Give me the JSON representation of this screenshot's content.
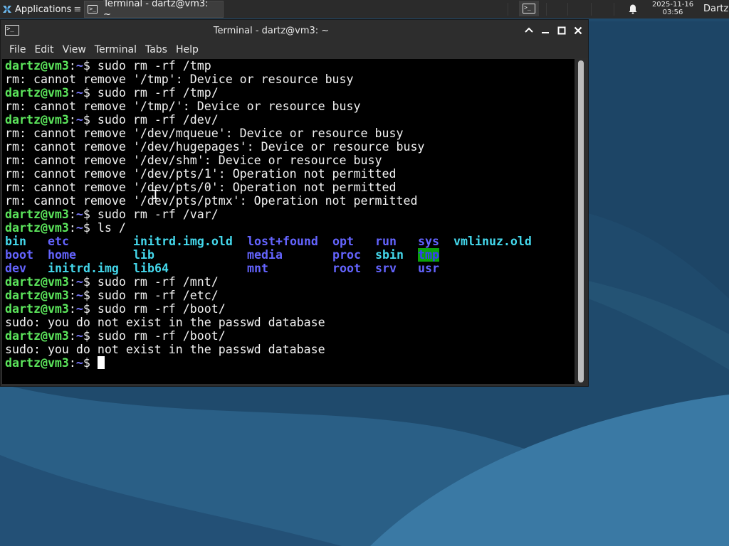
{
  "panel": {
    "applications_label": "Applications",
    "applications_suffix": "≡",
    "task_label": "Terminal - dartz@vm3: ~",
    "clock_date": "2025-11-16",
    "clock_time": "03:56",
    "user": "Dartz"
  },
  "window": {
    "title": "Terminal - dartz@vm3: ~",
    "controls": [
      "maximize-up",
      "minimize",
      "maximize",
      "close"
    ]
  },
  "menu": [
    "File",
    "Edit",
    "View",
    "Terminal",
    "Tabs",
    "Help"
  ],
  "prompt": {
    "user_host": "dartz@vm3",
    "sep": ":",
    "path": "~",
    "sigil": "$ "
  },
  "lines_before_ls": [
    {
      "type": "cmd",
      "text": "sudo rm -rf /tmp"
    },
    {
      "type": "out",
      "text": "rm: cannot remove '/tmp': Device or resource busy"
    },
    {
      "type": "cmd",
      "text": "sudo rm -rf /tmp/"
    },
    {
      "type": "out",
      "text": "rm: cannot remove '/tmp/': Device or resource busy"
    },
    {
      "type": "cmd",
      "text": "sudo rm -rf /dev/"
    },
    {
      "type": "out",
      "text": "rm: cannot remove '/dev/mqueue': Device or resource busy"
    },
    {
      "type": "out",
      "text": "rm: cannot remove '/dev/hugepages': Device or resource busy"
    },
    {
      "type": "out",
      "text": "rm: cannot remove '/dev/shm': Device or resource busy"
    },
    {
      "type": "out",
      "text": "rm: cannot remove '/dev/pts/1': Operation not permitted"
    },
    {
      "type": "out",
      "text": "rm: cannot remove '/dev/pts/0': Operation not permitted"
    },
    {
      "type": "out",
      "text": "rm: cannot remove '/dev/pts/ptmx': Operation not permitted"
    },
    {
      "type": "cmd",
      "text": "sudo rm -rf /var/"
    },
    {
      "type": "cmd",
      "text": "ls /"
    }
  ],
  "ls_output": [
    {
      "name": "bin",
      "kind": "link",
      "col": 0,
      "row": 0
    },
    {
      "name": "etc",
      "kind": "dir",
      "col": 1,
      "row": 0
    },
    {
      "name": "initrd.img.old",
      "kind": "link",
      "col": 2,
      "row": 0
    },
    {
      "name": "lost+found",
      "kind": "dir",
      "col": 3,
      "row": 0
    },
    {
      "name": "opt",
      "kind": "dir",
      "col": 4,
      "row": 0
    },
    {
      "name": "run",
      "kind": "dir",
      "col": 5,
      "row": 0
    },
    {
      "name": "sys",
      "kind": "dir",
      "col": 6,
      "row": 0
    },
    {
      "name": "vmlinuz.old",
      "kind": "link",
      "col": 7,
      "row": 0
    },
    {
      "name": "boot",
      "kind": "dir",
      "col": 0,
      "row": 1
    },
    {
      "name": "home",
      "kind": "dir",
      "col": 1,
      "row": 1
    },
    {
      "name": "lib",
      "kind": "link",
      "col": 2,
      "row": 1
    },
    {
      "name": "media",
      "kind": "dir",
      "col": 3,
      "row": 1
    },
    {
      "name": "proc",
      "kind": "dir",
      "col": 4,
      "row": 1
    },
    {
      "name": "sbin",
      "kind": "link",
      "col": 5,
      "row": 1
    },
    {
      "name": "tmp",
      "kind": "sticky",
      "col": 6,
      "row": 1
    },
    {
      "name": "dev",
      "kind": "dir",
      "col": 0,
      "row": 2
    },
    {
      "name": "initrd.img",
      "kind": "link",
      "col": 1,
      "row": 2
    },
    {
      "name": "lib64",
      "kind": "link",
      "col": 2,
      "row": 2
    },
    {
      "name": "mnt",
      "kind": "dir",
      "col": 3,
      "row": 2
    },
    {
      "name": "root",
      "kind": "dir",
      "col": 4,
      "row": 2
    },
    {
      "name": "srv",
      "kind": "dir",
      "col": 5,
      "row": 2
    },
    {
      "name": "usr",
      "kind": "dir",
      "col": 6,
      "row": 2
    }
  ],
  "lines_after_ls": [
    {
      "type": "cmd",
      "text": "sudo rm -rf /mnt/"
    },
    {
      "type": "cmd",
      "text": "sudo rm -rf /etc/"
    },
    {
      "type": "cmd",
      "text": "sudo rm -rf /boot/"
    },
    {
      "type": "out",
      "text": "sudo: you do not exist in the passwd database"
    },
    {
      "type": "cmd",
      "text": "sudo rm -rf /boot/"
    },
    {
      "type": "out",
      "text": "sudo: you do not exist in the passwd database"
    },
    {
      "type": "cmd",
      "text": ""
    }
  ],
  "colors": {
    "prompt_user": "#5ce65c",
    "prompt_path": "#7b7bff",
    "dir": "#6464ff",
    "link": "#44d8ec",
    "sticky_bg": "#0aa10a"
  }
}
